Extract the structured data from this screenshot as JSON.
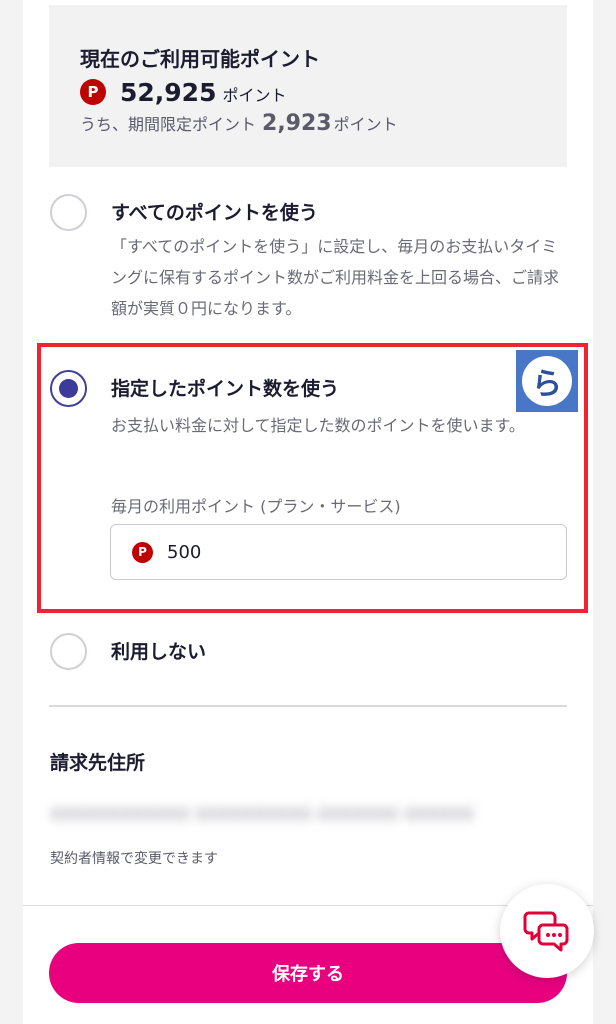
{
  "points": {
    "title": "現在のご利用可能ポイント",
    "icon_letter": "P",
    "amount": "52,925",
    "unit": "ポイント",
    "limited_prefix": "うち、期間限定ポイント",
    "limited_amount": "2,923",
    "limited_unit": "ポイント"
  },
  "options": {
    "all": {
      "label": "すべてのポイントを使う",
      "description": "「すべてのポイントを使う」に設定し、毎月のお支払いタイミングに保有するポイント数がご利用料金を上回る場合、ご請求額が実質０円になります。",
      "selected": false
    },
    "specified": {
      "label": "指定したポイント数を使う",
      "description": "お支払い料金に対して指定した数のポイントを使います。",
      "field_label": "毎月の利用ポイント (プラン・サービス)",
      "field_icon_letter": "P",
      "field_value": "500",
      "selected": true
    },
    "none": {
      "label": "利用しない",
      "selected": false
    }
  },
  "billing": {
    "title": "請求先住所",
    "address_blurred": "XXXXXXXXXXXX XXXXXXXXXX XXXXXXX XXXXXX",
    "note": "契約者情報で変更できます"
  },
  "watermark": {
    "glyph": "ら"
  },
  "save_button": {
    "label": "保存する"
  },
  "colors": {
    "accent_pink": "#e8007f",
    "radio_selected": "#3b3b99",
    "highlight_red": "#ee2530",
    "point_red": "#bf0000"
  }
}
